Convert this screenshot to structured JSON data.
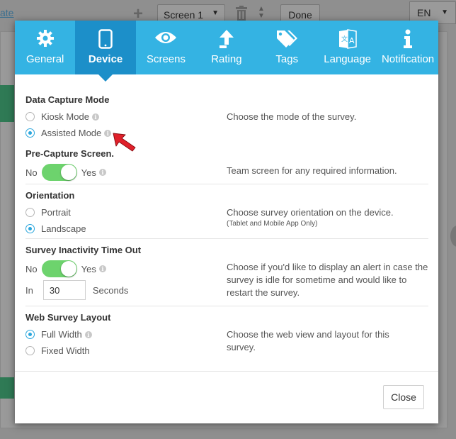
{
  "background": {
    "link_text": "ate",
    "screen_select": "Screen 1",
    "done_label": "Done",
    "lang_select": "EN"
  },
  "tabs": [
    {
      "label": "General",
      "icon": "gear-icon"
    },
    {
      "label": "Device",
      "icon": "tablet-icon",
      "active": true
    },
    {
      "label": "Screens",
      "icon": "eye-icon"
    },
    {
      "label": "Rating",
      "icon": "upload-arrow-icon"
    },
    {
      "label": "Tags",
      "icon": "tags-icon"
    },
    {
      "label": "Language",
      "icon": "translate-icon"
    },
    {
      "label": "Notification",
      "icon": "info-icon"
    }
  ],
  "data_capture": {
    "heading": "Data Capture Mode",
    "options": [
      {
        "label": "Kiosk Mode",
        "selected": false
      },
      {
        "label": "Assisted Mode",
        "selected": true
      }
    ],
    "description": "Choose the mode of the survey."
  },
  "pre_capture": {
    "heading": "Pre-Capture Screen.",
    "no_label": "No",
    "yes_label": "Yes",
    "enabled": true,
    "description": "Team screen for any required information."
  },
  "orientation": {
    "heading": "Orientation",
    "options": [
      {
        "label": "Portrait",
        "selected": false
      },
      {
        "label": "Landscape",
        "selected": true
      }
    ],
    "description": "Choose survey orientation on the device.",
    "note": "(Tablet and Mobile App Only)"
  },
  "inactivity": {
    "heading": "Survey Inactivity Time Out",
    "no_label": "No",
    "yes_label": "Yes",
    "enabled": true,
    "in_label": "In",
    "value": "30",
    "unit_label": "Seconds",
    "description": "Choose if you'd like to display an alert in case the survey is idle for sometime and would like to restart the survey."
  },
  "web_layout": {
    "heading": "Web Survey Layout",
    "options": [
      {
        "label": "Full Width",
        "selected": true
      },
      {
        "label": "Fixed Width",
        "selected": false
      }
    ],
    "description": "Choose the web view and layout for this survey."
  },
  "footer": {
    "close_label": "Close"
  },
  "colors": {
    "tab_bar": "#34b3e3",
    "tab_active": "#1c8fc9",
    "toggle_on": "#6dd36d",
    "radio_on": "#2ba6dc",
    "pointer": "#e0202a"
  }
}
